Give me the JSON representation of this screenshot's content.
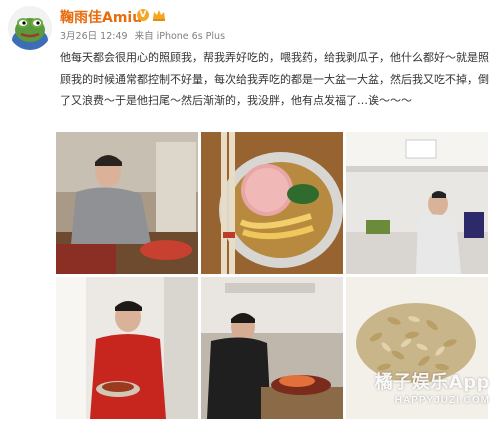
{
  "post": {
    "username": "鞠雨佳Amiu",
    "verified_badge": "V",
    "timestamp": "3月26日 12:49",
    "source": "来自 iPhone 6s Plus",
    "text": "他每天都会很用心的照顾我，帮我弄好吃的，喂我药，给我剥瓜子，他什么都好～就是照顾我的时候通常都控制不好量，每次给我弄吃的都是一大盆一大盆，然后我又吃不掉，倒了又浪费～于是他扫尾～然后渐渐的，我没胖，他有点发福了…诶～～～"
  },
  "photos": [
    {
      "subject": "man-cooking-at-table"
    },
    {
      "subject": "bowl-of-noodles-with-ham"
    },
    {
      "subject": "man-at-kitchen-counter"
    },
    {
      "subject": "man-in-red-shirt-holding-plate"
    },
    {
      "subject": "man-cooking-on-stove"
    },
    {
      "subject": "peeled-sunflower-seeds"
    }
  ],
  "watermark": {
    "name": "橘子娱乐App",
    "url": "HAPPYJUZI.COM"
  },
  "colors": {
    "username": "#e86b0c",
    "meta": "#808080",
    "text": "#333333",
    "verified": "#f5a623"
  }
}
